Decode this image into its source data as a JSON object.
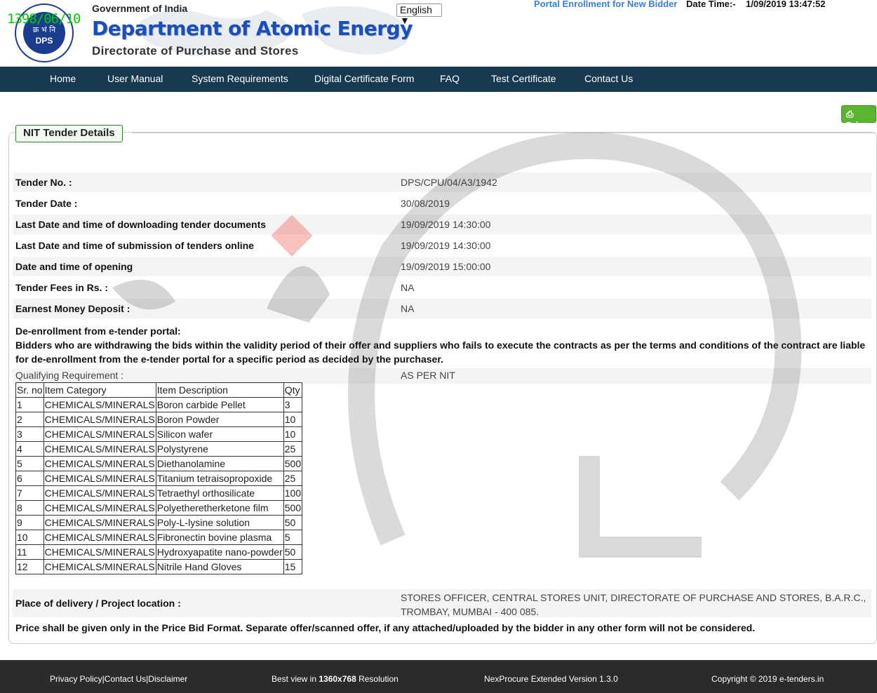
{
  "header": {
    "stamp": "1398/06/10",
    "logo_text": "DPS",
    "logo_hindi": "क्र भं नि",
    "government": "Government of India",
    "department": "Department of Atomic Energy",
    "directorate": "Directorate of Purchase and Stores",
    "language": "English ▼",
    "portal_link": "Portal Enrollment for New Bidder",
    "datetime_label": "Date Time:-",
    "datetime_value": "1/09/2019 13:47:52"
  },
  "nav": [
    "Home",
    "User Manual",
    "System Requirements",
    "Digital Certificate Form",
    "FAQ",
    "Test Certificate",
    "Contact Us"
  ],
  "print_label": "Print",
  "section_title": "NIT Tender Details",
  "details": [
    {
      "label": "Tender No. :",
      "value": "DPS/CPU/04/A3/1942"
    },
    {
      "label": "Tender Date :",
      "value": "30/08/2019"
    },
    {
      "label": "Last Date and time of downloading tender documents",
      "value": "19/09/2019 14:30:00"
    },
    {
      "label": "Last Date and time of submission of tenders online",
      "value": "19/09/2019 14:30:00"
    },
    {
      "label": "Date and time of opening",
      "value": "19/09/2019 15:00:00"
    },
    {
      "label": "Tender Fees in Rs. :",
      "value": "NA"
    },
    {
      "label": "Earnest Money Deposit :",
      "value": "NA"
    }
  ],
  "deenrollment_title": "De-enrollment from e-tender portal:",
  "deenrollment_text": "Bidders who are withdrawing the bids within the validity period of their offer and suppliers who fails to execute the contracts as per the terms and conditions of the contract are liable for de-enrollment from the e-tender portal for a specific period as decided by the purchaser.",
  "qualifying_label": "Qualifying Requirement :",
  "qualifying_value": "AS PER NIT",
  "items_header": [
    "Sr. no",
    "Item Category",
    "Item Description",
    "Qty"
  ],
  "items": [
    [
      "1",
      "CHEMICALS/MINERALS",
      "Boron carbide Pellet",
      "3"
    ],
    [
      "2",
      "CHEMICALS/MINERALS",
      "Boron Powder",
      "10"
    ],
    [
      "3",
      "CHEMICALS/MINERALS",
      "Silicon wafer",
      "10"
    ],
    [
      "4",
      "CHEMICALS/MINERALS",
      "Polystyrene",
      "25"
    ],
    [
      "5",
      "CHEMICALS/MINERALS",
      "Diethanolamine",
      "500"
    ],
    [
      "6",
      "CHEMICALS/MINERALS",
      "Titanium tetraisopropoxide",
      "25"
    ],
    [
      "7",
      "CHEMICALS/MINERALS",
      "Tetraethyl orthosilicate",
      "100"
    ],
    [
      "8",
      "CHEMICALS/MINERALS",
      "Polyetheretherketone film",
      "500"
    ],
    [
      "9",
      "CHEMICALS/MINERALS",
      "Poly-L-lysine solution",
      "50"
    ],
    [
      "10",
      "CHEMICALS/MINERALS",
      "Fibronectin bovine plasma",
      "5"
    ],
    [
      "11",
      "CHEMICALS/MINERALS",
      "Hydroxyapatite nano-powder",
      "50"
    ],
    [
      "12",
      "CHEMICALS/MINERALS",
      "Nitrile Hand Gloves",
      "15"
    ]
  ],
  "place_label": "Place of delivery / Project location :",
  "place_value": "STORES OFFICER, CENTRAL STORES UNIT, DIRECTORATE OF PURCHASE AND STORES, B.A.R.C., TROMBAY, MUMBAI - 400 085.",
  "price_note": "Price shall be given only in the Price Bid Format. Separate offer/scanned offer, if any attached/uploaded by the bidder in any other form will not be considered.",
  "footer": {
    "links": "Privacy Policy|Contact Us|Disclaimer",
    "best_view_prefix": "Best view in ",
    "best_view_res": "1360x768",
    "best_view_suffix": " Resolution",
    "version": "NexProcure Extended Version 1.3.0",
    "copyright": "Copyright © 2019 e-tenders.in"
  }
}
